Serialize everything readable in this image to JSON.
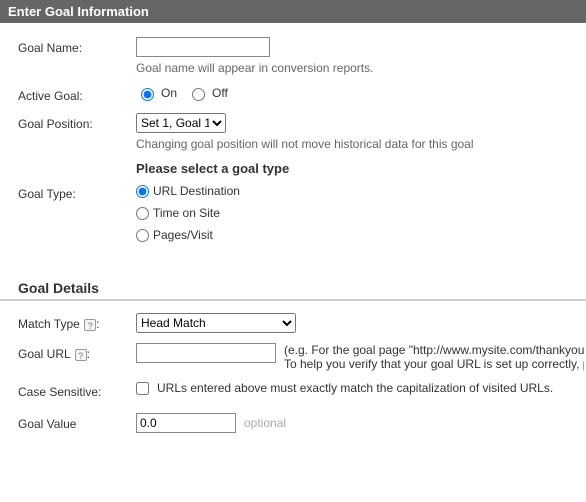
{
  "header": {
    "title": "Enter Goal Information"
  },
  "goal_info": {
    "name_label": "Goal Name:",
    "name_value": "",
    "name_hint": "Goal name will appear in conversion reports.",
    "active_label": "Active Goal:",
    "active_on": "On",
    "active_off": "Off",
    "position_label": "Goal Position:",
    "position_options": [
      "Set 1, Goal 1"
    ],
    "position_selected": "Set 1, Goal 1",
    "position_hint": "Changing goal position will not move historical data for this goal",
    "type_label": "Goal Type:",
    "type_prompt": "Please select a goal type",
    "type_options": {
      "url": "URL Destination",
      "time": "Time on Site",
      "pages": "Pages/Visit"
    }
  },
  "details": {
    "heading": "Goal Details",
    "match_label": "Match Type",
    "match_options": [
      "Head Match"
    ],
    "match_selected": "Head Match",
    "url_label": "Goal URL",
    "url_value": "",
    "url_hint_line1": "(e.g. For the goal page \"http://www.mysite.com/thankyou",
    "url_hint_line2": "To help you verify that your goal URL is set up correctly, p",
    "cs_label": "Case Sensitive:",
    "cs_hint": "URLs entered above must exactly match the capitalization of visited URLs.",
    "value_label": "Goal Value",
    "value_value": "0.0",
    "value_optional": "optional",
    "help_icon": "?"
  }
}
